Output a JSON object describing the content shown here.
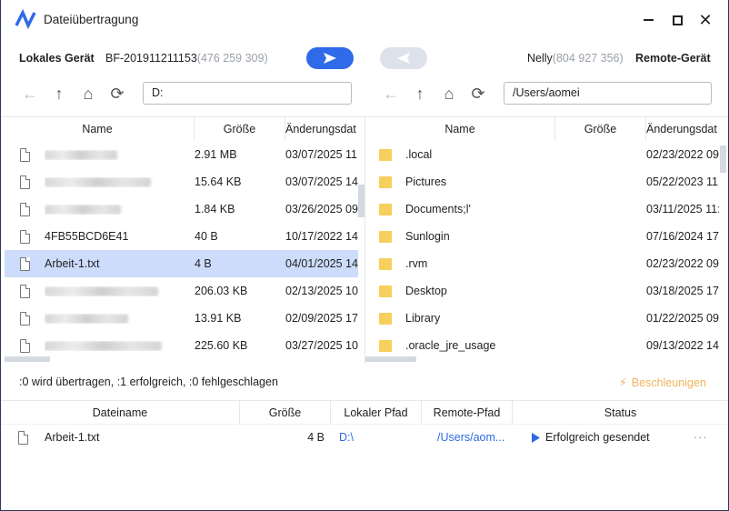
{
  "window": {
    "title": "Dateiübertragung",
    "colors": {
      "accent": "#2f6ae8",
      "selected_row": "#cddcfa",
      "accelerate": "#f0b35a"
    }
  },
  "local": {
    "label": "Lokales Gerät",
    "device": "BF-201911211153",
    "id": "(476 259 309)",
    "path": "D:"
  },
  "remote": {
    "label": "Remote-Gerät",
    "device": "Nelly",
    "id": "(804 927 356)",
    "path": "/Users/aomei"
  },
  "columns": {
    "name": "Name",
    "size": "Größe",
    "date": "Änderungsdat"
  },
  "local_files": [
    {
      "name": "",
      "size": "2.91 MB",
      "date": "03/07/2025 11:",
      "blurred": true
    },
    {
      "name": "",
      "size": "15.64 KB",
      "date": "03/07/2025 14",
      "blurred": true
    },
    {
      "name": "",
      "size": "1.84 KB",
      "date": "03/26/2025 09",
      "blurred": true
    },
    {
      "name": "4FB55BCD6E41",
      "size": "40 B",
      "date": "10/17/2022 14:"
    },
    {
      "name": "Arbeit-1.txt",
      "size": "4 B",
      "date": "04/01/2025 14",
      "selected": true
    },
    {
      "name": "",
      "size": "206.03 KB",
      "date": "02/13/2025 10",
      "blurred": true
    },
    {
      "name": "",
      "size": "13.91 KB",
      "date": "02/09/2025 17",
      "blurred": true
    },
    {
      "name": "",
      "size": "225.60 KB",
      "date": "03/27/2025 10",
      "blurred": true
    }
  ],
  "remote_files": [
    {
      "name": ".local",
      "size": "",
      "date": "02/23/2022 09"
    },
    {
      "name": "Pictures",
      "size": "",
      "date": "05/22/2023 11:"
    },
    {
      "name": "Documents;l'",
      "size": "",
      "date": "03/11/2025 11:4"
    },
    {
      "name": "Sunlogin",
      "size": "",
      "date": "07/16/2024 17:"
    },
    {
      "name": ".rvm",
      "size": "",
      "date": "02/23/2022 09"
    },
    {
      "name": "Desktop",
      "size": "",
      "date": "03/18/2025 17:"
    },
    {
      "name": "Library",
      "size": "",
      "date": "01/22/2025 09"
    },
    {
      "name": ".oracle_jre_usage",
      "size": "",
      "date": "09/13/2022 14:"
    }
  ],
  "transfer": {
    "summary": ":0 wird übertragen, :1 erfolgreich, :0 fehlgeschlagen",
    "accelerate": "Beschleunigen",
    "headers": [
      "Dateiname",
      "Größe",
      "Lokaler Pfad",
      "Remote-Pfad",
      "Status"
    ],
    "rows": [
      {
        "name": "Arbeit-1.txt",
        "size": "4 B",
        "local": "D:\\",
        "remote": "/Users/aom...",
        "status": "Erfolgreich gesendet",
        "more": "···"
      }
    ]
  }
}
